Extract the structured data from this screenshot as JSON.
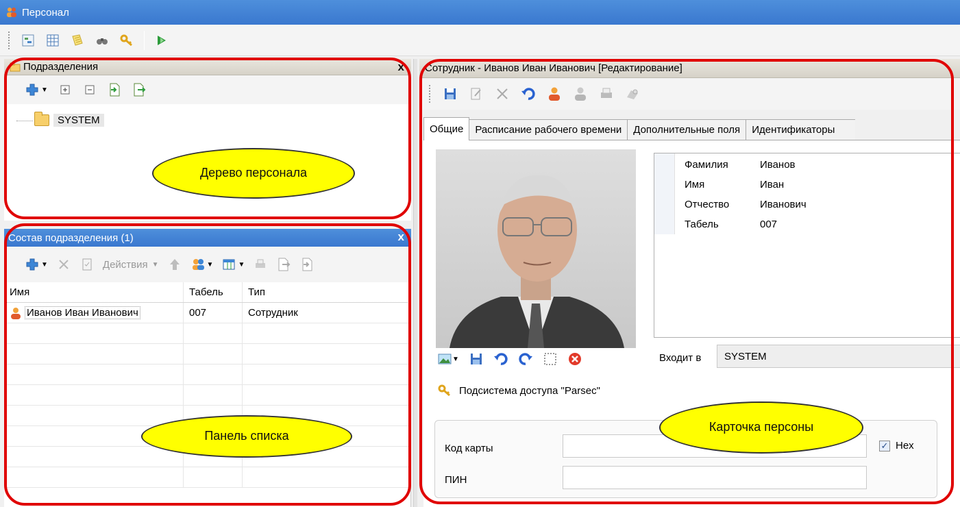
{
  "window": {
    "title": "Персонал"
  },
  "main_toolbar": {
    "icons": [
      "structure-icon",
      "grid-icon",
      "notes-icon",
      "binoculars-icon",
      "key-icon",
      "exit-icon"
    ]
  },
  "tree_panel": {
    "title": "Подразделения",
    "close": "x",
    "toolbar_icons": [
      "add-icon",
      "expand-icon",
      "collapse-icon",
      "import-icon",
      "export-icon"
    ],
    "nodes": [
      {
        "label": "SYSTEM"
      }
    ]
  },
  "list_panel": {
    "title": "Состав подразделения (1)",
    "close": "x",
    "actions_label": "Действия",
    "columns": [
      "Имя",
      "Табель",
      "Тип"
    ],
    "rows": [
      {
        "name": "Иванов Иван Иванович",
        "tab": "007",
        "type": "Сотрудник"
      }
    ]
  },
  "card_panel": {
    "title": "Сотрудник - Иванов Иван Иванович [Редактирование]",
    "tabs": [
      "Общие",
      "Расписание рабочего времени",
      "Дополнительные поля",
      "Идентификаторы"
    ],
    "props": [
      {
        "k": "Фамилия",
        "v": "Иванов"
      },
      {
        "k": "Имя",
        "v": "Иван"
      },
      {
        "k": "Отчество",
        "v": "Иванович"
      },
      {
        "k": "Табель",
        "v": "007"
      }
    ],
    "member_of_label": "Входит в",
    "member_of_value": "SYSTEM",
    "subsystem_label": "Подсистема доступа \"Parsec\"",
    "card_code_label": "Код карты",
    "card_code_value": "",
    "hex_label": "Hex",
    "hex_checked": true,
    "pin_label": "ПИН",
    "pin_value": ""
  },
  "callouts": {
    "tree": "Дерево персонала",
    "list": "Панель списка",
    "card": "Карточка персоны"
  },
  "colors": {
    "accent_blue": "#3a78cf",
    "callout_yellow": "#ffff00",
    "highlight_red": "#e00000"
  }
}
